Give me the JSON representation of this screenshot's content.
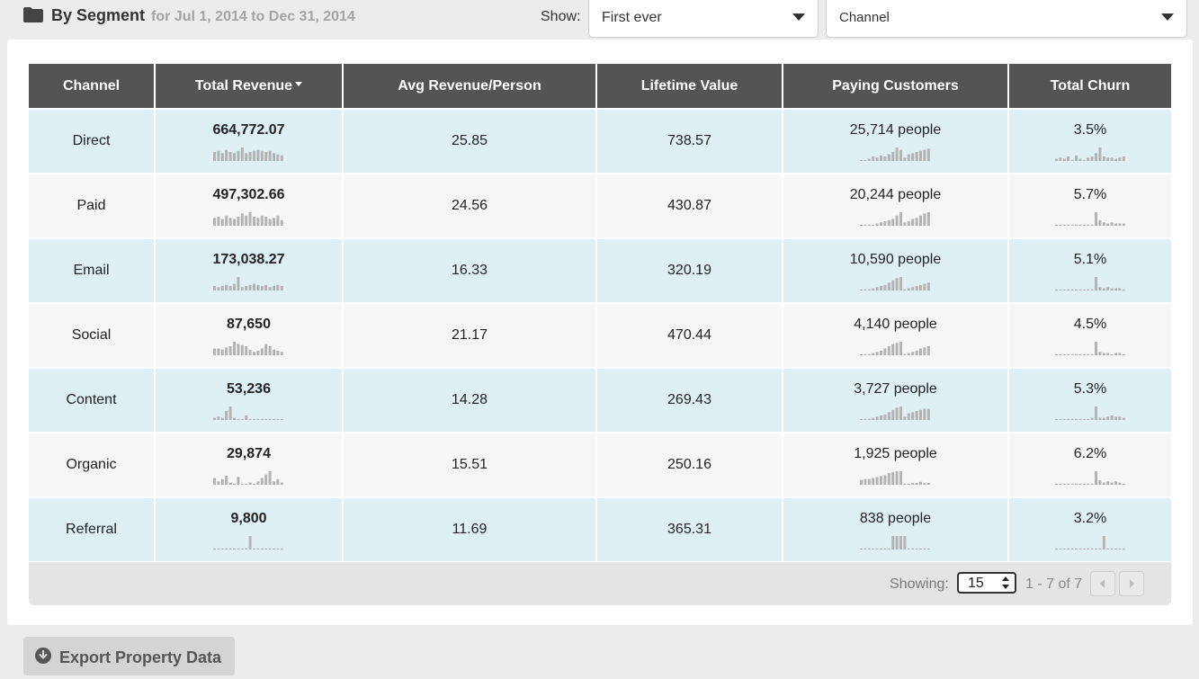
{
  "header": {
    "title": "By Segment",
    "date_range": "for Jul 1, 2014 to Dec 31, 2014",
    "show_label": "Show:",
    "show_value": "First ever",
    "group_value": "Channel"
  },
  "table": {
    "columns": [
      "Channel",
      "Total Revenue",
      "Avg Revenue/Person",
      "Lifetime Value",
      "Paying Customers",
      "Total Churn"
    ],
    "sorted_column": "Total Revenue",
    "rows": [
      {
        "channel": "Direct",
        "revenue": "664,772.07",
        "avg": "25.85",
        "ltv": "738.57",
        "customers": "25,714 people",
        "churn": "3.5%",
        "spark_revenue": [
          8,
          9,
          7,
          10,
          8,
          7,
          9,
          12,
          7,
          8,
          9,
          10,
          9,
          8,
          9,
          7,
          6,
          5
        ],
        "spark_customers": [
          1,
          1,
          2,
          4,
          3,
          5,
          4,
          6,
          8,
          12,
          10,
          3,
          6,
          7,
          8,
          9,
          10,
          11
        ],
        "spark_churn": [
          2,
          3,
          2,
          4,
          1,
          5,
          2,
          1,
          3,
          4,
          7,
          12,
          4,
          3,
          3,
          2,
          3,
          4
        ]
      },
      {
        "channel": "Paid",
        "revenue": "497,302.66",
        "avg": "24.56",
        "ltv": "430.87",
        "customers": "20,244 people",
        "churn": "5.7%",
        "spark_revenue": [
          7,
          8,
          6,
          9,
          7,
          6,
          8,
          11,
          9,
          12,
          8,
          7,
          9,
          8,
          6,
          7,
          9,
          5
        ],
        "spark_customers": [
          1,
          1,
          1,
          1,
          2,
          3,
          4,
          5,
          6,
          9,
          12,
          3,
          4,
          6,
          7,
          9,
          11,
          12
        ],
        "spark_churn": [
          1,
          1,
          1,
          1,
          1,
          1,
          1,
          1,
          1,
          1,
          12,
          5,
          3,
          2,
          3,
          2,
          2,
          2
        ]
      },
      {
        "channel": "Email",
        "revenue": "173,038.27",
        "avg": "16.33",
        "ltv": "320.19",
        "customers": "10,590 people",
        "churn": "5.1%",
        "spark_revenue": [
          4,
          3,
          4,
          5,
          4,
          6,
          12,
          3,
          4,
          5,
          6,
          5,
          4,
          5,
          3,
          4,
          5,
          4
        ],
        "spark_customers": [
          1,
          1,
          1,
          2,
          3,
          4,
          5,
          7,
          9,
          11,
          12,
          1,
          2,
          3,
          4,
          5,
          6,
          7
        ],
        "spark_churn": [
          1,
          1,
          1,
          1,
          1,
          1,
          1,
          1,
          1,
          1,
          12,
          3,
          2,
          3,
          2,
          2,
          2,
          1
        ]
      },
      {
        "channel": "Social",
        "revenue": "87,650",
        "avg": "21.17",
        "ltv": "470.44",
        "customers": "4,140 people",
        "churn": "4.5%",
        "spark_revenue": [
          6,
          6,
          5,
          7,
          8,
          12,
          10,
          9,
          8,
          5,
          3,
          4,
          6,
          10,
          8,
          5,
          4,
          3
        ],
        "spark_customers": [
          1,
          1,
          1,
          2,
          3,
          4,
          6,
          8,
          10,
          11,
          12,
          1,
          2,
          3,
          4,
          6,
          7,
          8
        ],
        "spark_churn": [
          1,
          1,
          1,
          1,
          1,
          1,
          1,
          1,
          1,
          1,
          12,
          3,
          2,
          2,
          1,
          2,
          2,
          1
        ]
      },
      {
        "channel": "Content",
        "revenue": "53,236",
        "avg": "14.28",
        "ltv": "269.43",
        "customers": "3,727 people",
        "churn": "5.3%",
        "spark_revenue": [
          2,
          3,
          2,
          8,
          12,
          2,
          1,
          1,
          4,
          1,
          1,
          1,
          1,
          1,
          1,
          1,
          1,
          1
        ],
        "spark_customers": [
          1,
          1,
          1,
          2,
          3,
          4,
          5,
          7,
          9,
          11,
          12,
          3,
          6,
          7,
          8,
          9,
          10,
          10
        ],
        "spark_churn": [
          1,
          1,
          1,
          1,
          1,
          1,
          1,
          1,
          1,
          2,
          12,
          2,
          2,
          3,
          4,
          3,
          3,
          2
        ]
      },
      {
        "channel": "Organic",
        "revenue": "29,874",
        "avg": "15.51",
        "ltv": "250.16",
        "customers": "1,925 people",
        "churn": "6.2%",
        "spark_revenue": [
          6,
          3,
          5,
          8,
          2,
          1,
          7,
          1,
          1,
          2,
          1,
          3,
          6,
          9,
          12,
          3,
          5,
          2
        ],
        "spark_customers": [
          5,
          6,
          6,
          7,
          8,
          9,
          10,
          12,
          13,
          14,
          14,
          1,
          1,
          2,
          2,
          3,
          2,
          2
        ],
        "spark_churn": [
          1,
          1,
          1,
          1,
          1,
          1,
          1,
          1,
          1,
          1,
          12,
          4,
          2,
          3,
          2,
          3,
          2,
          1
        ]
      },
      {
        "channel": "Referral",
        "revenue": "9,800",
        "avg": "11.69",
        "ltv": "365.31",
        "customers": "838 people",
        "churn": "3.2%",
        "spark_revenue": [
          1,
          1,
          1,
          1,
          1,
          1,
          1,
          1,
          1,
          12,
          1,
          1,
          1,
          1,
          1,
          1,
          1,
          1
        ],
        "spark_customers": [
          1,
          1,
          1,
          1,
          1,
          1,
          1,
          1,
          12,
          12,
          12,
          12,
          1,
          1,
          1,
          1,
          1,
          1
        ],
        "spark_churn": [
          1,
          1,
          1,
          1,
          1,
          1,
          1,
          1,
          1,
          1,
          1,
          1,
          12,
          1,
          1,
          1,
          1,
          1
        ]
      }
    ]
  },
  "pagination": {
    "showing_label": "Showing:",
    "per_page": "15",
    "range_text": "1 - 7 of 7"
  },
  "export": {
    "label": "Export Property Data"
  },
  "colors": {
    "header_bg": "#545454",
    "row_even": "#dff0f4",
    "row_odd": "#f5f7f6",
    "spark": "#b3b3b3"
  }
}
